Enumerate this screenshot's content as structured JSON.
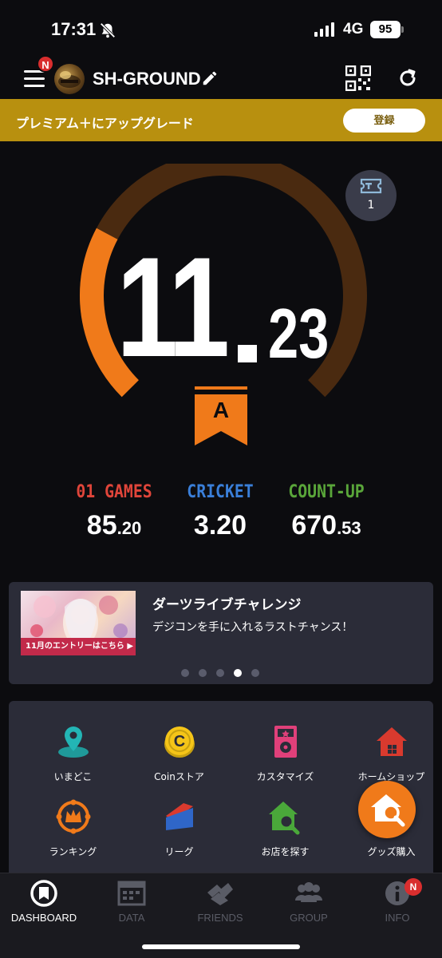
{
  "status_bar": {
    "time": "17:31",
    "network": "4G",
    "battery": "95"
  },
  "header": {
    "menu_badge": "N",
    "username": "SH-GROUND"
  },
  "premium": {
    "text": "プレミアム＋にアップグレード",
    "button": "登録"
  },
  "rating": {
    "integer": "11",
    "decimal": "23",
    "value": 11.23,
    "progress_fraction": 0.27,
    "rank": "A",
    "ticket_count": "1"
  },
  "stats": [
    {
      "label": "01 GAMES",
      "main": "85",
      "sub": ".20",
      "color": "#e0453a"
    },
    {
      "label": "CRICKET",
      "main": "3.20",
      "sub": "",
      "color": "#3a7fd9"
    },
    {
      "label": "COUNT-UP",
      "main": "670",
      "sub": ".53",
      "color": "#5aa63a"
    }
  ],
  "news": {
    "thumb_label": "11月のエントリーはこちら ▶",
    "title": "ダーツライブチャレンジ",
    "description": "デジコンを手に入れるラストチャンス！",
    "pages": 5,
    "active_page": 4
  },
  "menu": [
    {
      "label": "いまどこ",
      "icon": "map-pin-icon"
    },
    {
      "label": "Coinストア",
      "icon": "coin-icon"
    },
    {
      "label": "カスタマイズ",
      "icon": "customize-icon"
    },
    {
      "label": "ホームショップ",
      "icon": "home-shop-icon"
    },
    {
      "label": "ランキング",
      "icon": "ranking-icon"
    },
    {
      "label": "リーグ",
      "icon": "league-icon"
    },
    {
      "label": "お店を探す",
      "icon": "shop-search-icon"
    },
    {
      "label": "グッズ購入",
      "icon": "cart-icon"
    }
  ],
  "tabs": [
    {
      "label": "DASHBOARD",
      "active": true
    },
    {
      "label": "DATA",
      "active": false
    },
    {
      "label": "FRIENDS",
      "active": false
    },
    {
      "label": "GROUP",
      "active": false
    },
    {
      "label": "INFO",
      "active": false,
      "badge": "N"
    }
  ],
  "colors": {
    "accent": "#f07a1a",
    "premium": "#b8900f",
    "gauge_track": "#4a2a10"
  }
}
